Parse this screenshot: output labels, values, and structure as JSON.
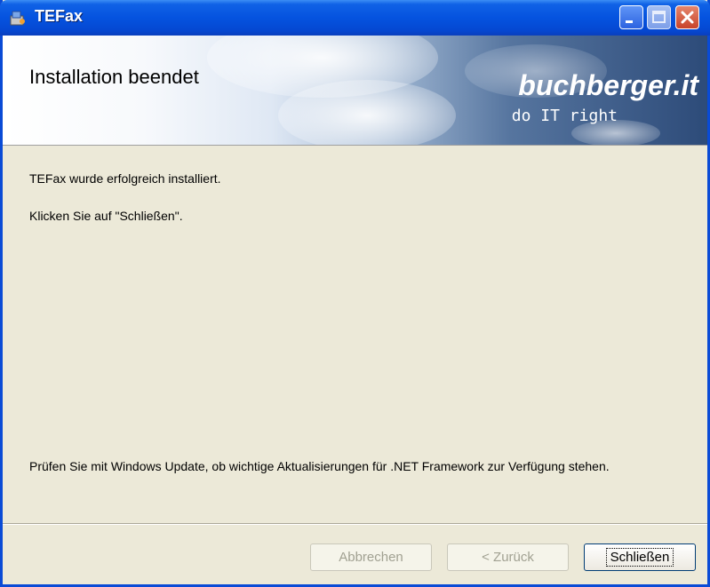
{
  "window": {
    "title": "TEFax"
  },
  "header": {
    "title": "Installation beendet",
    "brand_name": "buchberger.it",
    "brand_tagline": "do IT right"
  },
  "body": {
    "message1": "TEFax wurde erfolgreich installiert.",
    "message2": "Klicken Sie auf \"Schließen\".",
    "note": "Prüfen Sie mit Windows Update, ob wichtige Aktualisierungen für .NET Framework zur Verfügung stehen."
  },
  "buttons": {
    "cancel": "Abbrechen",
    "back": "< Zurück",
    "close": "Schließen"
  },
  "icons": {
    "app": "installer-icon",
    "minimize": "minimize-icon",
    "maximize": "maximize-icon",
    "close": "close-icon"
  },
  "colors": {
    "titlebar": "#0553df",
    "background": "#ece9d8",
    "close_button": "#c8432a"
  }
}
